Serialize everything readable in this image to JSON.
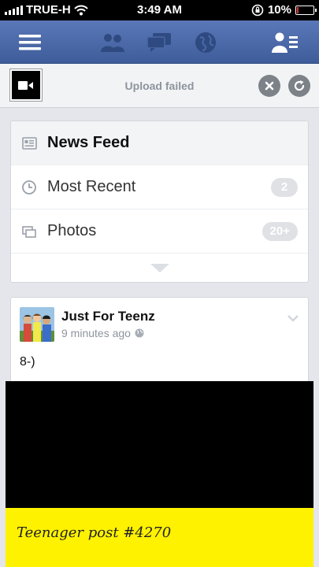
{
  "status_bar": {
    "carrier": "TRUE-H",
    "time": "3:49 AM",
    "battery_percent": "10%",
    "battery_level": 0.1
  },
  "navbar": {
    "icons": [
      "menu-icon",
      "friend-requests-icon",
      "messages-icon",
      "notifications-globe-icon",
      "contacts-icon"
    ]
  },
  "upload": {
    "status": "Upload failed"
  },
  "feed_menu": {
    "title": "News Feed",
    "items": [
      {
        "label": "Most Recent",
        "count": "2"
      },
      {
        "label": "Photos",
        "count": "20+"
      }
    ]
  },
  "post": {
    "author": "Just For Teenz",
    "time": "9 minutes ago",
    "text": "8-)",
    "image_caption": "Teenager post #4270"
  },
  "colors": {
    "nav_blue": "#4b69a8",
    "badge_gray": "#dfe1e5",
    "image_yellow": "#fff200"
  }
}
